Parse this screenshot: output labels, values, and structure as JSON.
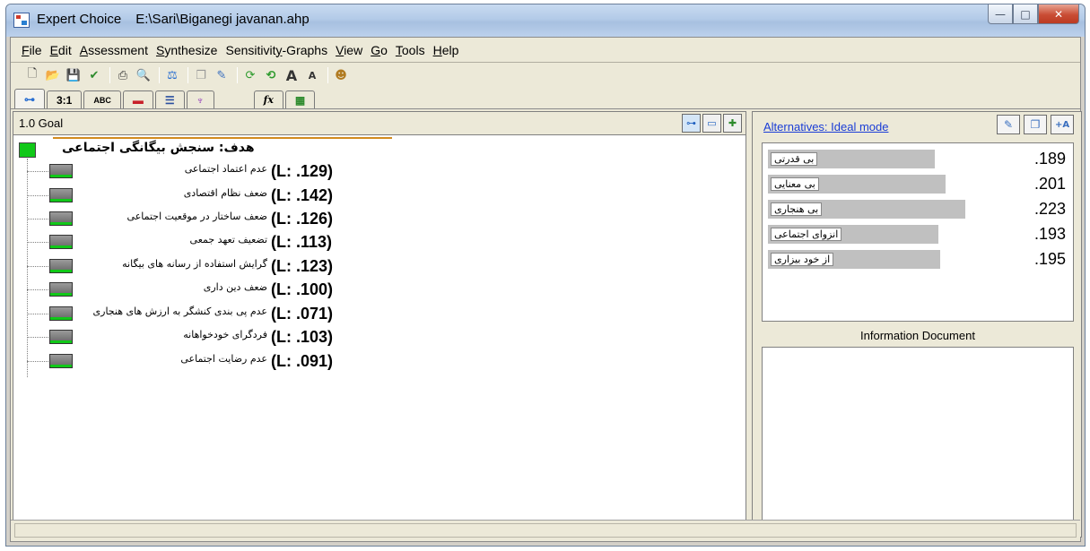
{
  "window": {
    "app_name": "Expert Choice",
    "file_path": "E:\\Sari\\Biganegi javanan.ahp",
    "minimize": "—",
    "maximize": "□",
    "close": "✕"
  },
  "menu": [
    {
      "pre": "",
      "u": "F",
      "post": "ile"
    },
    {
      "pre": "",
      "u": "E",
      "post": "dit"
    },
    {
      "pre": "",
      "u": "A",
      "post": "ssessment"
    },
    {
      "pre": "",
      "u": "S",
      "post": "ynthesize"
    },
    {
      "pre": "Sensitivit",
      "u": "y",
      "post": "-Graphs"
    },
    {
      "pre": "",
      "u": "V",
      "post": "iew"
    },
    {
      "pre": "",
      "u": "G",
      "post": "o"
    },
    {
      "pre": "",
      "u": "T",
      "post": "ools"
    },
    {
      "pre": "",
      "u": "H",
      "post": "elp"
    }
  ],
  "toolbar_icons": [
    "new-file-icon",
    "open-folder-icon",
    "save-icon",
    "check-icon",
    "print-icon",
    "print-preview-icon",
    "balance-icon",
    "copy-icon",
    "paint-icon",
    "refresh-icon",
    "refresh-all-icon",
    "font-larger-icon",
    "font-smaller-icon",
    "people-icon"
  ],
  "tabs": [
    {
      "name": "tab-tree-view",
      "label": "",
      "icon": "tree-icon"
    },
    {
      "name": "tab-pairwise-numerical",
      "label": "3:1"
    },
    {
      "name": "tab-pairwise-verbal",
      "label": "ABC"
    },
    {
      "name": "tab-graphical",
      "label": "",
      "icon": "bars-icon"
    },
    {
      "name": "tab-questionnaire",
      "label": "",
      "icon": "list-icon"
    },
    {
      "name": "tab-direct",
      "label": "",
      "icon": "scale-icon"
    },
    {
      "name": "tab-formula",
      "label": "fx"
    },
    {
      "name": "tab-data-grid",
      "label": "",
      "icon": "grid-icon"
    }
  ],
  "left_pane": {
    "node_id": "1.0 Goal",
    "goal": "هدف: سنجش بیگانگی اجتماعی",
    "criteria": [
      {
        "label": "عدم اعتماد اجتماعی",
        "local": "(L: .129)"
      },
      {
        "label": "ضعف نظام اقتصادی",
        "local": "(L: .142)"
      },
      {
        "label": "ضعف ساختار در موقعیت اجتماعی",
        "local": "(L: .126)"
      },
      {
        "label": "تضعیف تعهد جمعی",
        "local": "(L: .113)"
      },
      {
        "label": "گرایش استفاده از رسانه های بیگانه",
        "local": "(L: .123)"
      },
      {
        "label": "ضعف دین داری",
        "local": "(L: .100)"
      },
      {
        "label": "عدم پی بندی کنشگر به ارزش های هنجاری",
        "local": "(L: .071)"
      },
      {
        "label": "فردگرای خودخواهانه",
        "local": "(L: .103)"
      },
      {
        "label": "عدم رضایت اجتماعی",
        "local": "(L: .091)"
      }
    ]
  },
  "right_pane": {
    "title": "Alternatives: Ideal mode",
    "alternatives": [
      {
        "name": "بی قدرتی",
        "value": ".189",
        "score": 0.189
      },
      {
        "name": "بی معنایی",
        "value": ".201",
        "score": 0.201
      },
      {
        "name": "بی هنجاری",
        "value": ".223",
        "score": 0.223
      },
      {
        "name": "انزوای اجتماعی",
        "value": ".193",
        "score": 0.193
      },
      {
        "name": "از خود بیزاری",
        "value": ".195",
        "score": 0.195
      }
    ],
    "info_title": "Information Document"
  },
  "colors": {
    "goal_green": "#10c818",
    "link_blue": "#1a3dd6",
    "orange_line": "#d28b20"
  }
}
